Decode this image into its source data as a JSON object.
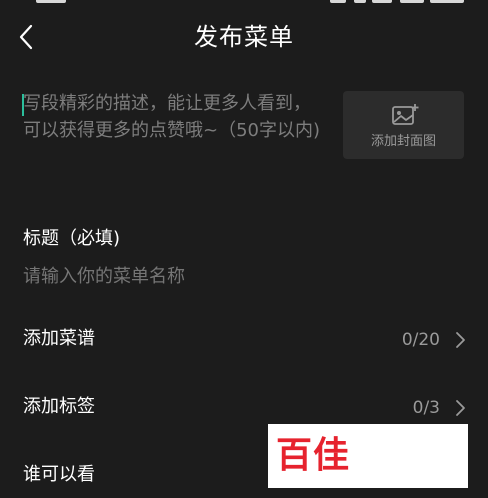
{
  "header": {
    "title": "发布菜单"
  },
  "description": {
    "placeholder": "写段精彩的描述，能让更多人看到，可以获得更多的点赞哦~（50字以内)"
  },
  "cover": {
    "label": "添加封面图",
    "icon": "add-image-icon"
  },
  "title_field": {
    "label": "标题（必填)",
    "placeholder": "请输入你的菜单名称"
  },
  "rows": [
    {
      "label": "添加菜谱",
      "value": "0/20"
    },
    {
      "label": "添加标签",
      "value": "0/3"
    },
    {
      "label": "谁可以看",
      "value": ""
    }
  ],
  "watermark": {
    "text": "百佳"
  },
  "colors": {
    "background": "#1c1c1c",
    "caret": "#2bbf9c",
    "muted": "#7d7d7d",
    "watermark_red": "#e6232e"
  }
}
